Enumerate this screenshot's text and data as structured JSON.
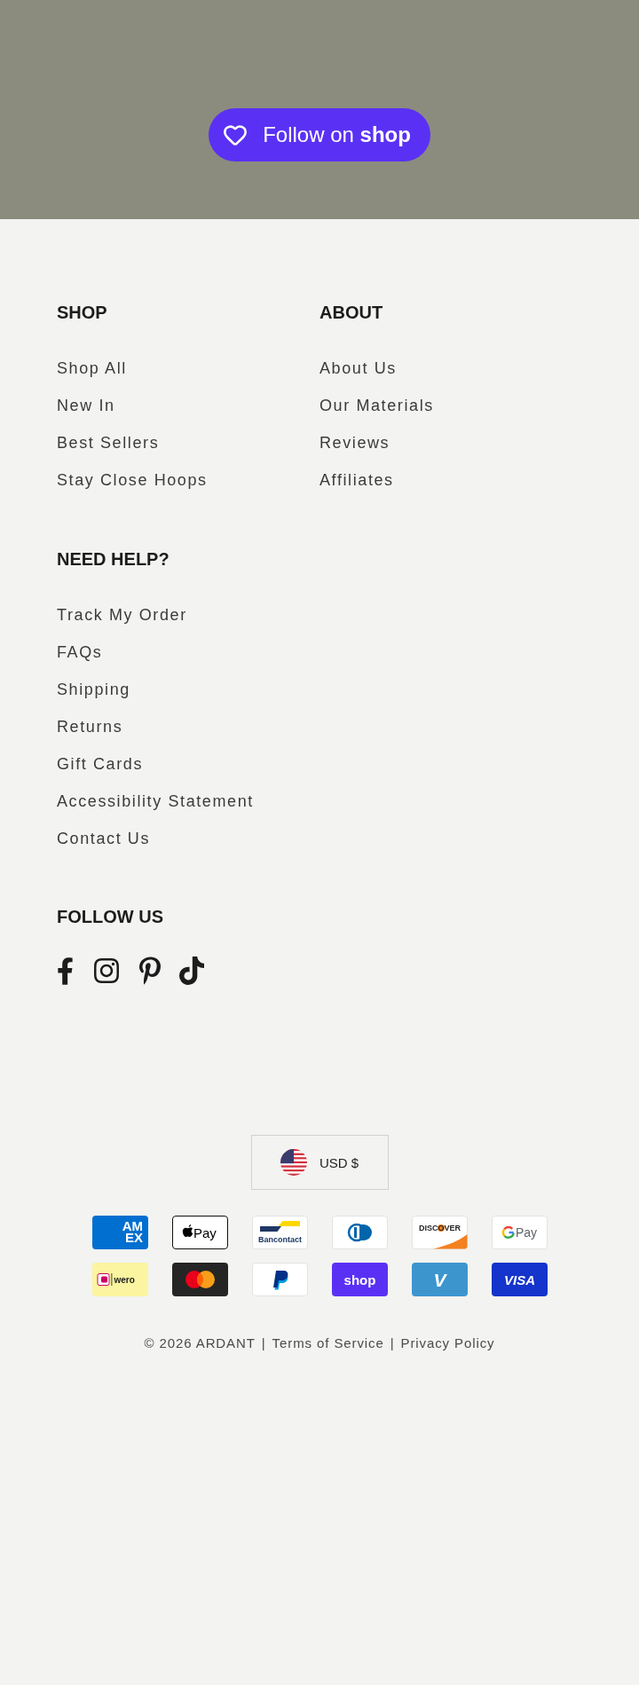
{
  "banner": {
    "follow_button": {
      "label": "Follow on **shop**"
    }
  },
  "link_columns": [
    {
      "heading": "SHOP",
      "links": [
        "Shop All",
        "New In",
        "Best Sellers",
        "Stay Close Hoops"
      ]
    },
    {
      "heading": "ABOUT",
      "links": [
        "About Us",
        "Our Materials",
        "Reviews",
        "Affiliates"
      ]
    },
    {
      "heading": "NEED HELP?",
      "links": [
        "Track My Order",
        "FAQs",
        "Shipping",
        "Returns",
        "Gift Cards",
        "Accessibility Statement",
        "Contact Us"
      ]
    }
  ],
  "follow_us": {
    "heading": "FOLLOW US",
    "social_links": [
      {
        "kind": "facebook"
      },
      {
        "kind": "instagram"
      },
      {
        "kind": "pinterest"
      },
      {
        "kind": "tiktok"
      }
    ]
  },
  "currency_selector": {
    "value": "USD $"
  },
  "payment_methods": [
    {
      "kind": "amex",
      "label_lines": [
        "AM",
        "EX"
      ]
    },
    {
      "kind": "apple_pay",
      "label": "Pay"
    },
    {
      "kind": "bancontact",
      "label": "Bancontact"
    },
    {
      "kind": "diners"
    },
    {
      "kind": "discover",
      "label": "DISCOVER"
    },
    {
      "kind": "google_pay",
      "label": "Pay"
    },
    {
      "kind": "wero",
      "label": "wero"
    },
    {
      "kind": "mastercard"
    },
    {
      "kind": "paypal"
    },
    {
      "kind": "shop_pay",
      "label": "shop"
    },
    {
      "kind": "venmo",
      "label": "V"
    },
    {
      "kind": "visa",
      "label": "VISA"
    }
  ],
  "legal_line": {
    "copyright": "© 2026 ARDANT",
    "links": [
      {
        "separator": "|",
        "label": "Terms of Service"
      },
      {
        "separator": "|",
        "label": "Privacy Policy"
      }
    ]
  }
}
